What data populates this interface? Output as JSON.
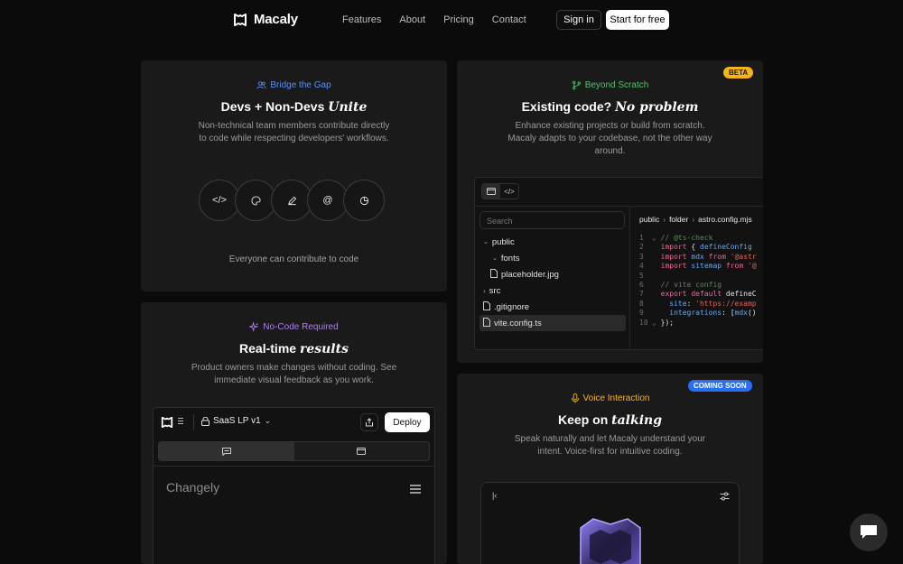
{
  "nav": {
    "brand": "Macaly",
    "links": [
      "Features",
      "About",
      "Pricing",
      "Contact"
    ],
    "sign_in": "Sign in",
    "start": "Start for free"
  },
  "card1": {
    "tag": "Bridge the Gap",
    "tag_color": "#5b8ff0",
    "title_plain": "Devs + Non-Devs",
    "title_italic": "Unite",
    "desc": "Non-technical team members contribute directly to code while respecting developers' workflows.",
    "icons": [
      "code-icon",
      "palette-icon",
      "pen-icon",
      "at-icon",
      "chart-icon"
    ],
    "footer": "Everyone can contribute to code"
  },
  "card2": {
    "badge": "BETA",
    "tag": "Beyond Scratch",
    "tag_color": "#4fc26b",
    "title_plain": "Existing code?",
    "title_italic": "No problem",
    "desc": "Enhance existing projects or build from scratch. Macaly adapts to your codebase, not the other way around.",
    "editor": {
      "search_placeholder": "Search",
      "tree": [
        "public",
        "fonts",
        "placeholder.jpg",
        "src",
        ".gitignore",
        "vite.config.ts"
      ],
      "breadcrumb": [
        "public",
        "folder",
        "astro.config.mjs"
      ],
      "code_lines": [
        "// @ts-check",
        "import { defineConfig",
        "import mdx from '@astr",
        "import sitemap from '@",
        "",
        "// vite config",
        "export default defineC",
        "  site: 'https://examp",
        "  integrations: [mdx()",
        "});"
      ]
    }
  },
  "card3": {
    "tag": "No-Code Required",
    "tag_color": "#b07cf5",
    "title_plain": "Real-time",
    "title_italic": "results",
    "desc": "Product owners make changes without coding. See immediate visual feedback as you work.",
    "app": {
      "project": "SaaS LP v1",
      "deploy": "Deploy",
      "site_name": "Changely"
    }
  },
  "card4": {
    "badge": "COMING SOON",
    "tag": "Voice Interaction",
    "tag_color": "#f5b515",
    "title_plain": "Keep on",
    "title_italic": "talking",
    "desc": "Speak naturally and let Macaly understand your intent. Voice-first for intuitive coding."
  }
}
